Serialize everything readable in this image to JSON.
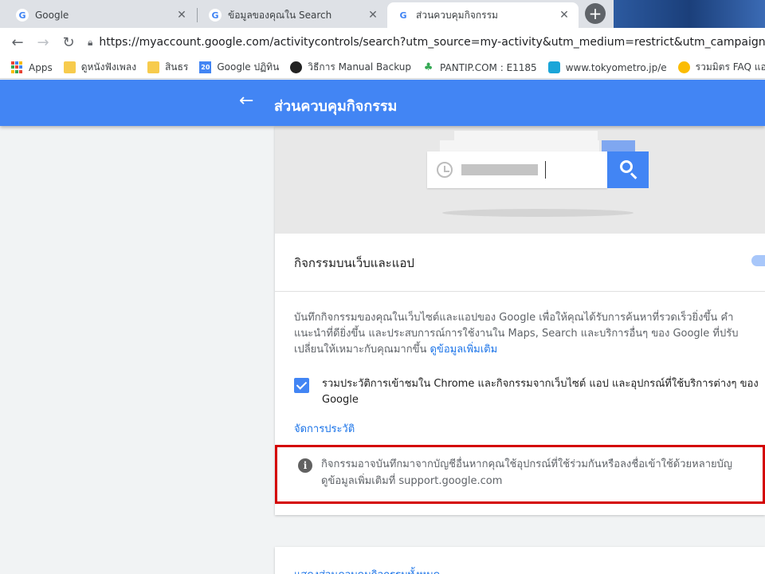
{
  "tabs": [
    {
      "title": "Google",
      "favicon": "G"
    },
    {
      "title": "ข้อมูลของคุณใน Search",
      "favicon": "G"
    },
    {
      "title": "ส่วนควบคุมกิจกรรม",
      "favicon": "G"
    }
  ],
  "address_bar": {
    "url": "https://myaccount.google.com/activitycontrols/search?utm_source=my-activity&utm_medium=restrict&utm_campaign&continue=h"
  },
  "bookmarks": [
    {
      "label": "Apps",
      "icon": "apps-grid-icon"
    },
    {
      "label": "ดูหนังฟังเพลง",
      "icon": "folder-icon"
    },
    {
      "label": "สินธร",
      "icon": "folder-icon"
    },
    {
      "label": "Google ปฏิทิน",
      "icon": "calendar-icon",
      "badge": "20"
    },
    {
      "label": "วิธีการ Manual Backup",
      "icon": "site-icon"
    },
    {
      "label": "PANTIP.COM : E1185",
      "icon": "cactus-icon"
    },
    {
      "label": "www.tokyometro.jp/e",
      "icon": "metro-icon"
    },
    {
      "label": "รวมมิตร FAQ แอร์เอเชีย",
      "icon": "smile-icon"
    }
  ],
  "header": {
    "title": "ส่วนควบคุมกิจกรรม"
  },
  "section": {
    "title": "กิจกรรมบนเว็บและแอป",
    "description": "บันทึกกิจกรรมของคุณในเว็บไซต์และแอปของ Google เพื่อให้คุณได้รับการค้นหาที่รวดเร็วยิ่งขึ้น คำแนะนำที่ดียิ่งขึ้น และประสบการณ์การใช้งานใน Maps, Search และบริการอื่นๆ ของ Google ที่ปรับเปลี่ยนให้เหมาะกับคุณมากขึ้น",
    "learn_more": "ดูข้อมูลเพิ่มเติม",
    "checkbox_label": "รวมประวัติการเข้าชมใน Chrome และกิจกรรมจากเว็บไซต์ แอป และอุปกรณ์ที่ใช้บริการต่างๆ ของ Google",
    "manage_link": "จัดการประวัติ",
    "info_line1": "กิจกรรมอาจบันทึกมาจากบัญชีอื่นหากคุณใช้อุปกรณ์ที่ใช้ร่วมกันหรือลงชื่อเข้าใช้ด้วยหลายบัญ",
    "info_line2": "ดูข้อมูลเพิ่มเติมที่ support.google.com"
  },
  "footer_card": {
    "link": "แสดงส่วนควบคุมกิจกรรมทั้งหมด"
  },
  "colors": {
    "header_blue": "#4285f4",
    "link_blue": "#1a73e8",
    "highlight_red": "#d40000"
  }
}
